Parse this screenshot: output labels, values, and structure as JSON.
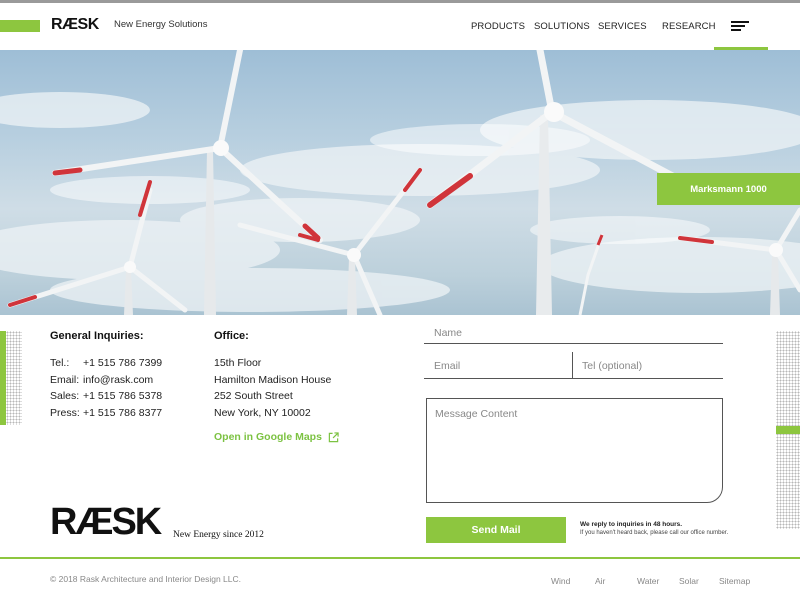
{
  "header": {
    "logo": "RÆSK",
    "tagline": "New Energy Solutions",
    "nav": [
      "PRODUCTS",
      "SOLUTIONS",
      "SERVICES",
      "RESEARCH"
    ],
    "menu_icon": "hamburger-menu-icon"
  },
  "hero": {
    "tag": "Marksmann 1000"
  },
  "contact": {
    "general_title": "General Inquiries:",
    "general": [
      {
        "key": "Tel.:",
        "value": "+1 515 786 7399"
      },
      {
        "key": "Email:",
        "value": "info@rask.com"
      },
      {
        "key": "Sales:",
        "value": "+1 515 786 5378"
      },
      {
        "key": "Press:",
        "value": "+1 515 786 8377"
      }
    ],
    "office_title": "Office:",
    "office_lines": [
      "15th Floor",
      "Hamilton Madison House",
      "252 South Street",
      "New York, NY 10002"
    ],
    "maps_link": "Open in Google Maps",
    "maps_icon": "external-link-icon"
  },
  "form": {
    "name_placeholder": "Name",
    "email_placeholder": "Email",
    "tel_placeholder": "Tel (optional)",
    "message_placeholder": "Message Content",
    "send_label": "Send Mail",
    "reply_note": "We reply to inquiries in 48 hours.",
    "reply_sub": "If you haven't heard back, please call our office number."
  },
  "brand": {
    "logo": "RÆSK",
    "since": "New Energy since 2012"
  },
  "footer": {
    "copyright": "© 2018 Rask Architecture and Interior Design LLC.",
    "links": [
      "Wind",
      "Air",
      "Water",
      "Solar",
      "Sitemap"
    ]
  },
  "colors": {
    "accent": "#8dc63f",
    "text": "#222222",
    "muted": "#888888"
  }
}
